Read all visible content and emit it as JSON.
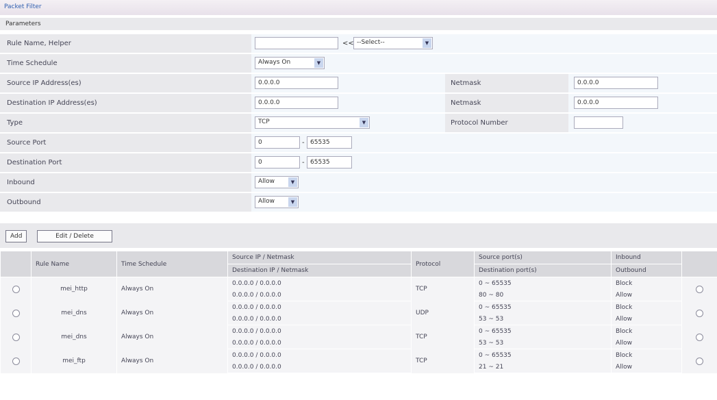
{
  "title": "Packet Filter",
  "section": "Parameters",
  "form": {
    "rule_name_label": "Rule Name, Helper",
    "rule_name_value": "",
    "helper_sep": "<<",
    "helper_select": "--Select--",
    "time_schedule_label": "Time Schedule",
    "time_schedule_value": "Always On",
    "src_ip_label": "Source IP Address(es)",
    "src_ip_value": "0.0.0.0",
    "src_netmask_label": "Netmask",
    "src_netmask_value": "0.0.0.0",
    "dst_ip_label": "Destination IP Address(es)",
    "dst_ip_value": "0.0.0.0",
    "dst_netmask_label": "Netmask",
    "dst_netmask_value": "0.0.0.0",
    "type_label": "Type",
    "type_value": "TCP",
    "protocol_number_label": "Protocol Number",
    "protocol_number_value": "",
    "src_port_label": "Source Port",
    "src_port_from": "0",
    "src_port_sep": "-",
    "src_port_to": "65535",
    "dst_port_label": "Destination Port",
    "dst_port_from": "0",
    "dst_port_sep": "-",
    "dst_port_to": "65535",
    "inbound_label": "Inbound",
    "inbound_value": "Allow",
    "outbound_label": "Outbound",
    "outbound_value": "Allow"
  },
  "buttons": {
    "add": "Add",
    "edit_delete": "Edit / Delete"
  },
  "table": {
    "headers": {
      "rule_name": "Rule Name",
      "time_schedule": "Time Schedule",
      "src_ip": "Source IP / Netmask",
      "dst_ip": "Destination IP / Netmask",
      "protocol": "Protocol",
      "src_port": "Source port(s)",
      "dst_port": "Destination port(s)",
      "inbound": "Inbound",
      "outbound": "Outbound"
    },
    "rows": [
      {
        "name": "mei_http",
        "schedule": "Always On",
        "src": "0.0.0.0 / 0.0.0.0",
        "dst": "0.0.0.0 / 0.0.0.0",
        "protocol": "TCP",
        "src_port": "0 ~ 65535",
        "dst_port": "80 ~ 80",
        "inbound": "Block",
        "outbound": "Allow"
      },
      {
        "name": "mei_dns",
        "schedule": "Always On",
        "src": "0.0.0.0 / 0.0.0.0",
        "dst": "0.0.0.0 / 0.0.0.0",
        "protocol": "UDP",
        "src_port": "0 ~ 65535",
        "dst_port": "53 ~ 53",
        "inbound": "Block",
        "outbound": "Allow"
      },
      {
        "name": "mei_dns",
        "schedule": "Always On",
        "src": "0.0.0.0 / 0.0.0.0",
        "dst": "0.0.0.0 / 0.0.0.0",
        "protocol": "TCP",
        "src_port": "0 ~ 65535",
        "dst_port": "53 ~ 53",
        "inbound": "Block",
        "outbound": "Allow"
      },
      {
        "name": "mei_ftp",
        "schedule": "Always On",
        "src": "0.0.0.0 / 0.0.0.0",
        "dst": "0.0.0.0 / 0.0.0.0",
        "protocol": "TCP",
        "src_port": "0 ~ 65535",
        "dst_port": "21 ~ 21",
        "inbound": "Block",
        "outbound": "Allow"
      }
    ]
  }
}
